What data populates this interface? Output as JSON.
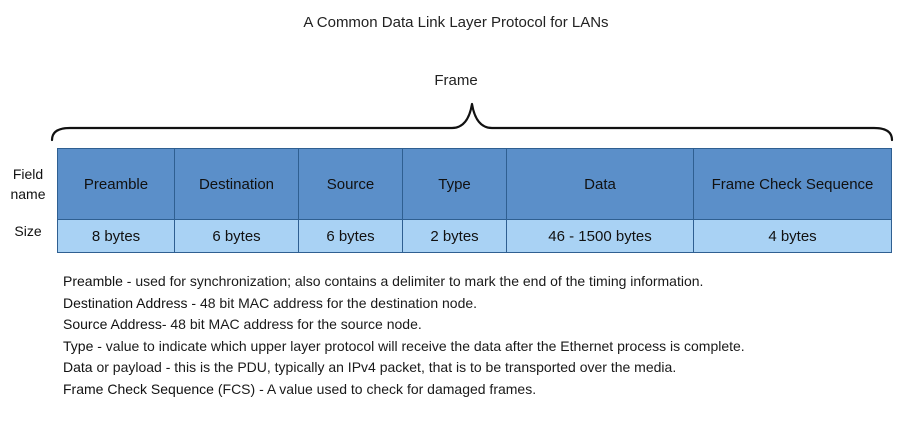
{
  "title": "A Common Data Link Layer Protocol for LANs",
  "frame_label": "Frame",
  "row_labels": {
    "field_name": "Field name",
    "size": "Size"
  },
  "fields": [
    {
      "name": "Preamble",
      "size": "8 bytes"
    },
    {
      "name": "Destination",
      "size": "6 bytes"
    },
    {
      "name": "Source",
      "size": "6 bytes"
    },
    {
      "name": "Type",
      "size": "2 bytes"
    },
    {
      "name": "Data",
      "size": "46 - 1500 bytes"
    },
    {
      "name": "Frame Check Sequence",
      "size": "4 bytes"
    }
  ],
  "descriptions": [
    {
      "term": "Preamble",
      "text": " - used for synchronization; also contains a delimiter to mark the end of the timing information."
    },
    {
      "term": "Destination Address",
      "text": " - 48 bit MAC address for the destination node."
    },
    {
      "term": "Source Address",
      "text": "- 48 bit MAC address for the source node."
    },
    {
      "term": "Type",
      "text": " - value to indicate which upper layer protocol will receive the data after the Ethernet process is complete."
    },
    {
      "term": "Data",
      "text": " or payload - this is the PDU, typically an IPv4 packet, that is to be transported over the media."
    },
    {
      "term": "Frame Check Sequence",
      "text": " (FCS) - A value used to check for damaged frames."
    }
  ],
  "colors": {
    "header_fill": "#5b8fc9",
    "size_fill": "#a9d2f4",
    "border": "#2f5f91"
  }
}
